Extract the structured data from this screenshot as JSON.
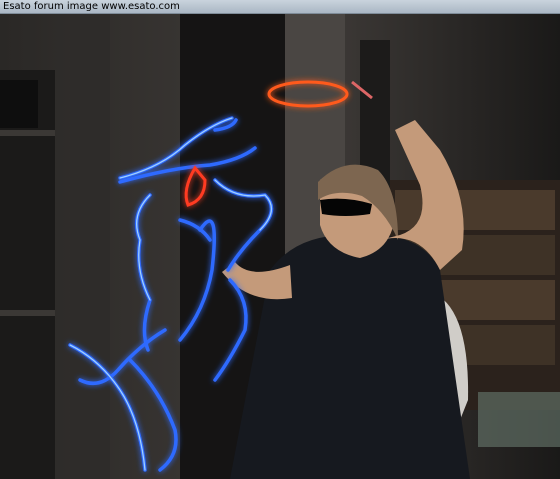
{
  "caption": "Esato forum image www.esato.com",
  "colors": {
    "light_blue": "#2f6bff",
    "light_glow": "#9fd0ff",
    "halo_orange": "#ff5a1f",
    "wall": "#3a3734",
    "shirt": "#16191f"
  },
  "icons": [
    "light-painted-dog",
    "light-halo",
    "light-wand"
  ]
}
